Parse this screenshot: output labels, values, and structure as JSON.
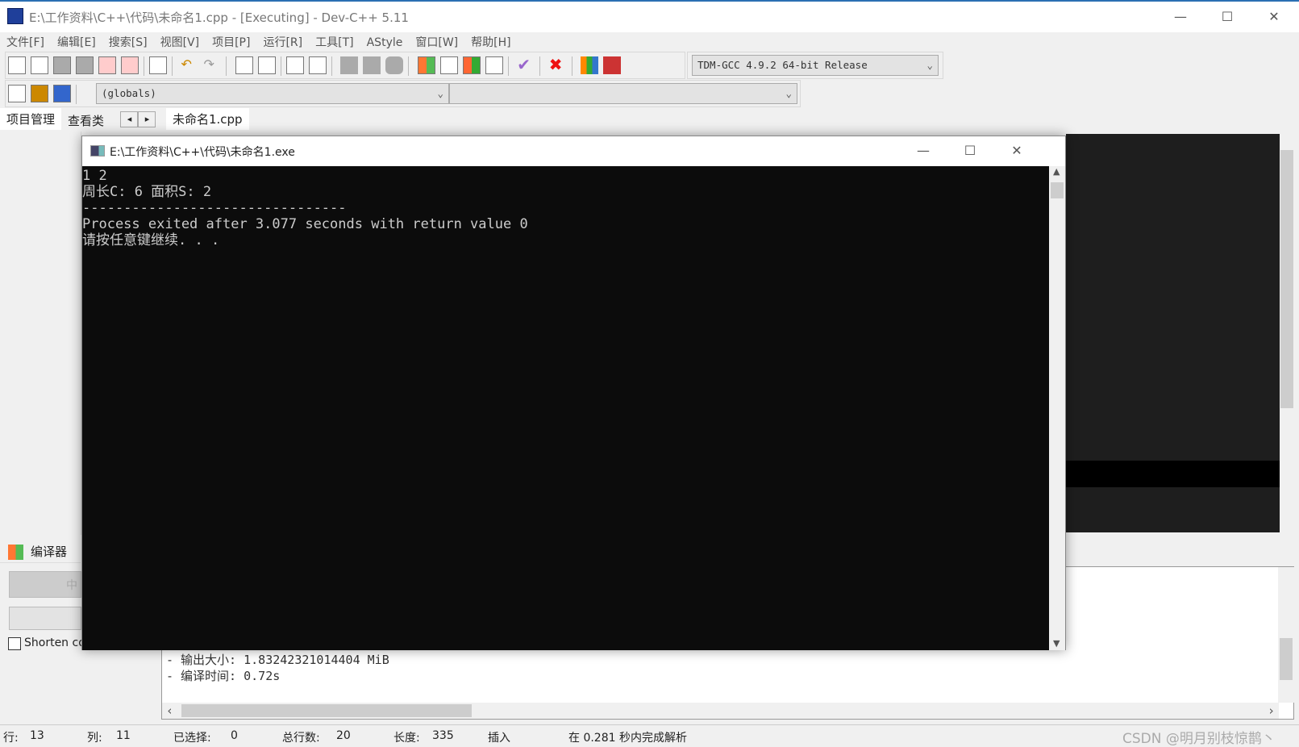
{
  "window": {
    "title": "E:\\工作资料\\C++\\代码\\未命名1.cpp - [Executing] - Dev-C++ 5.11",
    "minimize": "—",
    "maximize": "☐",
    "close": "✕"
  },
  "menu": [
    "文件[F]",
    "编辑[E]",
    "搜索[S]",
    "视图[V]",
    "项目[P]",
    "运行[R]",
    "工具[T]",
    "AStyle",
    "窗口[W]",
    "帮助[H]"
  ],
  "toolbar": {
    "compiler": "TDM-GCC 4.9.2 64-bit Release",
    "scope": "(globals)",
    "scope2": ""
  },
  "tabs": {
    "project": "项目管理",
    "classes": "查看类",
    "prev": "◂",
    "next": "▸",
    "file": "未命名1.cpp"
  },
  "bottom": {
    "tab": "编译器",
    "button_partial": "中",
    "shorten_label": "Shorten co",
    "output_lines": [
      "- 输出大小: 1.83242321014404 MiB",
      "- 编译时间: 0.72s"
    ]
  },
  "console": {
    "title": "E:\\工作资料\\C++\\代码\\未命名1.exe",
    "lines": [
      "1 2",
      "周长C: 6 面积S: 2",
      "--------------------------------",
      "Process exited after 3.077 seconds with return value 0",
      "请按任意键继续. . ."
    ]
  },
  "status": {
    "line_label": "行:",
    "line": "13",
    "col_label": "列:",
    "col": "11",
    "sel_label": "已选择:",
    "sel": "0",
    "total_label": "总行数:",
    "total": "20",
    "len_label": "长度:",
    "len": "335",
    "mode": "插入",
    "parse": "在 0.281 秒内完成解析"
  },
  "watermark": "CSDN @明月别枝惊鹊丶"
}
